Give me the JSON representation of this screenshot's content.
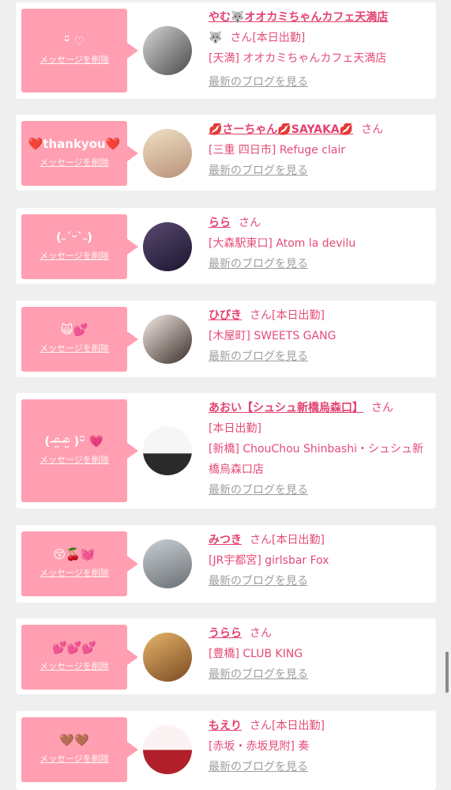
{
  "delete_label": "メッセージを削除",
  "blog_label": "最新のブログを見る",
  "san_label": "さん",
  "items": [
    {
      "message": "ᵕ̈ ♡",
      "name": "やむ🐺オオカミちゃんカフェ天満店",
      "extra": "🐺",
      "status": "[本日出勤]",
      "shop": "[天満] オオカミちゃんカフェ天満店",
      "avatar_colors": [
        "#cfcfcf",
        "#4a4a4a"
      ]
    },
    {
      "message": "❤️thankyou❤️",
      "name": "💋さーちゃん💋SAYAKA💋",
      "extra": "",
      "status": "",
      "shop": "[三重 四日市] Refuge clair",
      "avatar_colors": [
        "#e8d3b0",
        "#b9927a"
      ]
    },
    {
      "message": "(˶ˊᵕˋ˵)",
      "name": "らら",
      "extra": "",
      "status": "",
      "shop": "[大森駅東口] Atom la devilu",
      "avatar_colors": [
        "#3d2f4f",
        "#1b1530"
      ]
    },
    {
      "message": "🙀💕",
      "name": "ひびき",
      "extra": "",
      "status": "[本日出勤]",
      "shop": "[木屋町] SWEETS GANG",
      "avatar_colors": [
        "#f0e4dc",
        "#3c2e2a"
      ]
    },
    {
      "message": "( ᵔ̴̶̤ ᵔ̴̶̤ )ᵕ̈ 💗",
      "name": "あおい【シュシュ新橋烏森口】",
      "extra": "",
      "status": "[本日出勤]",
      "shop": "[新橋] ChouChou Shinbashi・シュシュ新橋烏森口店",
      "avatar_colors": [
        "#f4f4f4",
        "#2a2a2a"
      ]
    },
    {
      "message": "😚🍒💓",
      "name": "みつき",
      "extra": "",
      "status": "[本日出勤]",
      "shop": "[JR宇都宮] girlsbar Fox",
      "avatar_colors": [
        "#b8c0c6",
        "#6b6f73"
      ]
    },
    {
      "message": "💕💕💕",
      "name": "うらら",
      "extra": "",
      "status": "",
      "shop": "[豊橋] CLUB KING",
      "avatar_colors": [
        "#d7a35a",
        "#7a4a22"
      ]
    },
    {
      "message": "🤎🤎",
      "name": "もえり",
      "extra": "",
      "status": "[本日出勤]",
      "shop": "[赤坂・赤坂見附] 奏",
      "avatar_colors": [
        "#fbeeee",
        "#b1202a"
      ]
    }
  ]
}
